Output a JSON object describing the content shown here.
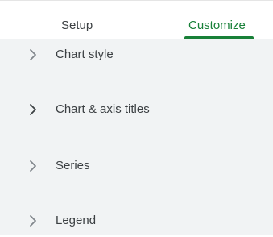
{
  "tabs": {
    "setup_label": "Setup",
    "customize_label": "Customize"
  },
  "sections": [
    {
      "label": "Chart style",
      "icon": "chevron-right-icon",
      "chevron_color": "#80868b"
    },
    {
      "label": "Chart & axis titles",
      "icon": "chevron-right-icon",
      "chevron_color": "#3c4043"
    },
    {
      "label": "Series",
      "icon": "chevron-right-icon",
      "chevron_color": "#80868b"
    },
    {
      "label": "Legend",
      "icon": "chevron-right-icon",
      "chevron_color": "#80868b"
    }
  ],
  "colors": {
    "accent": "#188038",
    "panel_bg": "#f1f3f4",
    "text": "#3c4043"
  }
}
